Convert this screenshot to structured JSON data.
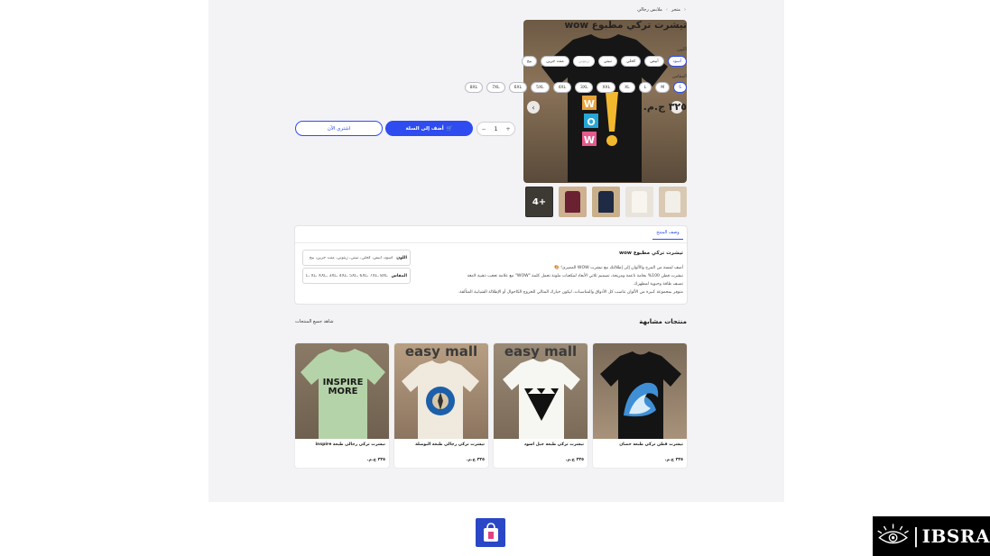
{
  "breadcrumb": {
    "home": "متجر",
    "category": "ملابس رجالي"
  },
  "product": {
    "title": "تيشرت تركي مطبوع wow",
    "color_label": "اللون",
    "colors": [
      {
        "label": "أسود",
        "state": "active"
      },
      {
        "label": "أبيض",
        "state": "normal"
      },
      {
        "label": "كحلي",
        "state": "normal"
      },
      {
        "label": "نبيتي",
        "state": "normal"
      },
      {
        "label": "زيتوني",
        "state": "disabled"
      },
      {
        "label": "منت جرين",
        "state": "normal"
      },
      {
        "label": "بيج",
        "state": "normal"
      }
    ],
    "size_label": "المقاس",
    "sizes": [
      {
        "label": "S",
        "state": "active"
      },
      {
        "label": "M",
        "state": "normal"
      },
      {
        "label": "L",
        "state": "normal"
      },
      {
        "label": "XL",
        "state": "normal"
      },
      {
        "label": "XXL",
        "state": "normal"
      },
      {
        "label": "3XL",
        "state": "normal"
      },
      {
        "label": "4XL",
        "state": "normal"
      },
      {
        "label": "5XL",
        "state": "normal"
      },
      {
        "label": "6XL",
        "state": "normal"
      },
      {
        "label": "7XL",
        "state": "normal"
      },
      {
        "label": "8XL",
        "state": "normal"
      }
    ],
    "price": "٣٢٥ ج.م.",
    "quantity": "1",
    "qty_plus": "+",
    "qty_minus": "−",
    "add_to_cart": "أضف إلى السلة",
    "buy_now": "اشتري الآن",
    "thumbs_more": "4+",
    "prev_arrow": "‹",
    "next_arrow": "›"
  },
  "description": {
    "tab": "وصف المنتج",
    "title": "تيشرت تركي مطبوع wow",
    "lines": [
      "أضف لمسة من المرح والألوان إلى إطلالتك مع تيشرت WOW المصري! 🎨",
      "تيشرت قطن 100% بخامة ناعمة ومريحة، تصميم ثلاثي الأبعاد لمكعبات ملونة تحمل كلمة \"WOW\" مع علامة تعجب ذهبية لامعة",
      "تضيف طاقة وحيوية لمظهرك.",
      "متوفر بمجموعة كبيرة من الألوان تناسب كل الأذواق والمناسبات، ليكون خيارك المثالي للخروج الكاجوال أو الإطلالة الشبابية المتألقة."
    ],
    "spec_color_key": "اللون",
    "spec_color_val": "أسود، أبيض، كحلي، نبيتي، زيتوني، منت جرين، بيج",
    "spec_size_key": "المقاس",
    "spec_size_val": "S، M، L، XL، XXL، 3XL، 4XL، 5XL، 6XL، 7XL، 8XL"
  },
  "similar": {
    "title": "منتجات مشابهة",
    "see_all": "شاهد جميع المنتجات",
    "items": [
      {
        "name": "تيشرت قطن تركي طبعة حصان",
        "price": "٣٢٥ ج.م.",
        "brand": ""
      },
      {
        "name": "تيشرت تركي طبعة جبل اسود",
        "price": "٣٢٥ ج.م.",
        "brand": "easy mall"
      },
      {
        "name": "تيشرت تركي رجالي طبعة البوصلة",
        "price": "٣٢٥ ج.م.",
        "brand": "easy mall"
      },
      {
        "name": "تيشرت تركي رجالي طبعة inspire",
        "price": "٣٢٥ ج.م.",
        "brand": ""
      }
    ]
  },
  "shirt_print": {
    "letters": [
      "W",
      "O",
      "W"
    ]
  },
  "card_print": {
    "inspire_line1": "INSPIRE",
    "inspire_line2": "MORE"
  },
  "watermark": {
    "text": "IBSRA"
  },
  "colors": {
    "accent": "#2f4cf0",
    "panel": "#f3f3f5"
  }
}
